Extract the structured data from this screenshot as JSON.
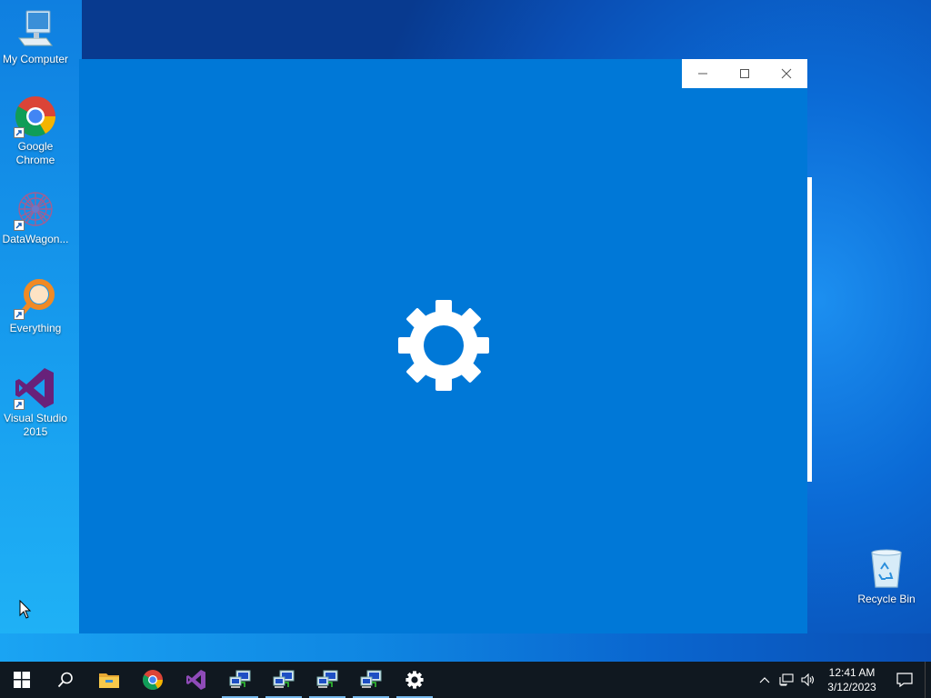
{
  "desktop": {
    "icons": [
      {
        "label": "My Computer",
        "icon": "computer-icon"
      },
      {
        "label": "Google Chrome",
        "icon": "chrome-icon"
      },
      {
        "label": "DataWagon...",
        "icon": "datawagon-icon"
      },
      {
        "label": "Everything",
        "icon": "everything-search-icon"
      },
      {
        "label": "Visual Studio 2015",
        "icon": "visual-studio-icon"
      },
      {
        "label": "Recycle Bin",
        "icon": "recycle-bin-icon"
      }
    ]
  },
  "window": {
    "state": "loading",
    "splash_icon": "gear-icon",
    "background": "#0078d7",
    "caption_buttons": [
      "minimize",
      "maximize",
      "close"
    ]
  },
  "taskbar": {
    "buttons": [
      {
        "name": "start",
        "icon": "windows-logo-icon"
      },
      {
        "name": "search",
        "icon": "search-icon"
      },
      {
        "name": "file-explorer",
        "icon": "folder-icon"
      },
      {
        "name": "chrome",
        "icon": "chrome-icon"
      },
      {
        "name": "visual-studio",
        "icon": "visual-studio-icon"
      },
      {
        "name": "app-1",
        "icon": "network-computer-icon",
        "running": true
      },
      {
        "name": "app-2",
        "icon": "network-computer-icon",
        "running": true
      },
      {
        "name": "app-3",
        "icon": "network-computer-icon",
        "running": true
      },
      {
        "name": "app-4",
        "icon": "network-computer-icon",
        "running": true
      },
      {
        "name": "settings",
        "icon": "gear-icon",
        "running": true
      }
    ],
    "tray": {
      "time": "12:41 AM",
      "date": "3/12/2023"
    }
  },
  "colors": {
    "taskbar": "#101820",
    "accent": "#0078d7",
    "running_indicator": "#76b9ed"
  }
}
